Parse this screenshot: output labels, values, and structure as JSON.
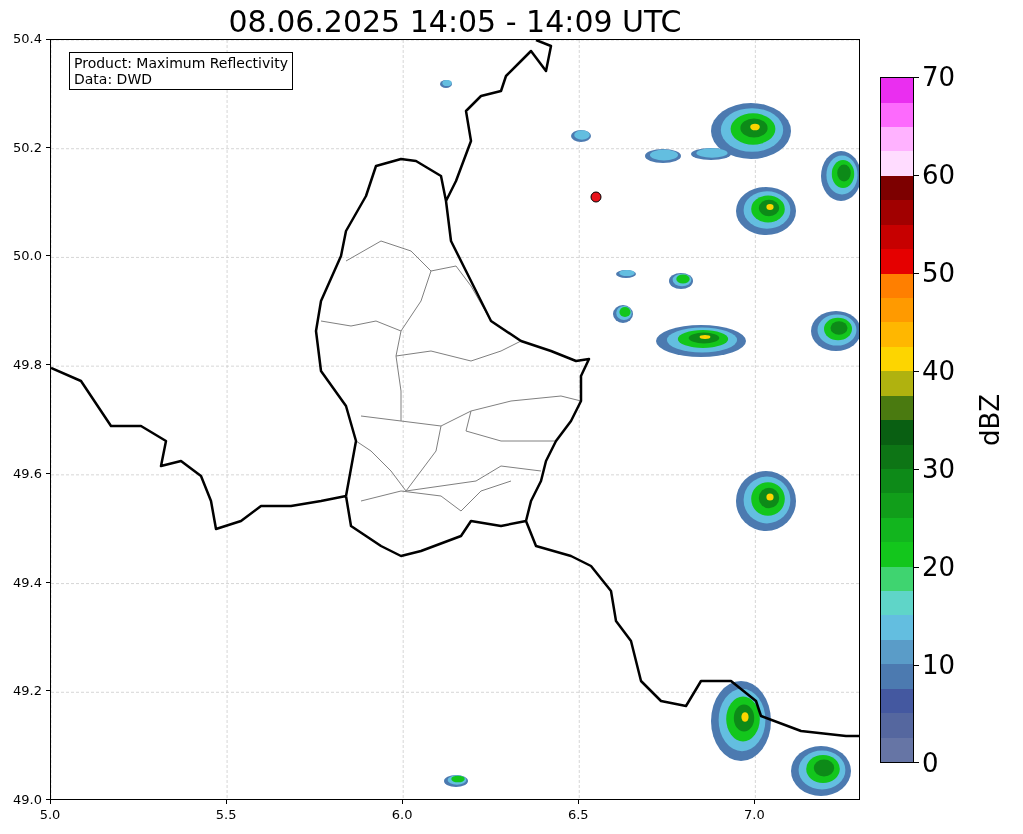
{
  "title": "08.06.2025 14:05 - 14:09 UTC",
  "annotation": [
    "Product: Maximum Reflectivity",
    "Data: DWD"
  ],
  "x_ticks": [
    "5.0",
    "5.5",
    "6.0",
    "6.5",
    "7.0"
  ],
  "y_ticks": [
    "50.4",
    "50.2",
    "50.0",
    "49.8",
    "49.6",
    "49.4",
    "49.2",
    "49.0"
  ],
  "colorbar": {
    "label": "dBZ",
    "ticks": [
      "70",
      "60",
      "50",
      "40",
      "30",
      "20",
      "10",
      "0"
    ],
    "segments": [
      {
        "color": "#6675a5"
      },
      {
        "color": "#55679f"
      },
      {
        "color": "#4458a0"
      },
      {
        "color": "#4c7ab0"
      },
      {
        "color": "#5a9cc8"
      },
      {
        "color": "#63bee0"
      },
      {
        "color": "#5fd5c8"
      },
      {
        "color": "#3fd470"
      },
      {
        "color": "#13c61c"
      },
      {
        "color": "#12b51e"
      },
      {
        "color": "#119e1a"
      },
      {
        "color": "#0d8a18"
      },
      {
        "color": "#0d7515"
      },
      {
        "color": "#095f12"
      },
      {
        "color": "#4a7a10"
      },
      {
        "color": "#b0b20f"
      },
      {
        "color": "#fdd500"
      },
      {
        "color": "#ffb700"
      },
      {
        "color": "#ff9a00"
      },
      {
        "color": "#ff7f00"
      },
      {
        "color": "#e50000"
      },
      {
        "color": "#c70000"
      },
      {
        "color": "#a10000"
      },
      {
        "color": "#7d0000"
      },
      {
        "color": "#ffdcff"
      },
      {
        "color": "#ffb2ff"
      },
      {
        "color": "#fd6afd"
      },
      {
        "color": "#ea2ef0"
      }
    ]
  }
}
